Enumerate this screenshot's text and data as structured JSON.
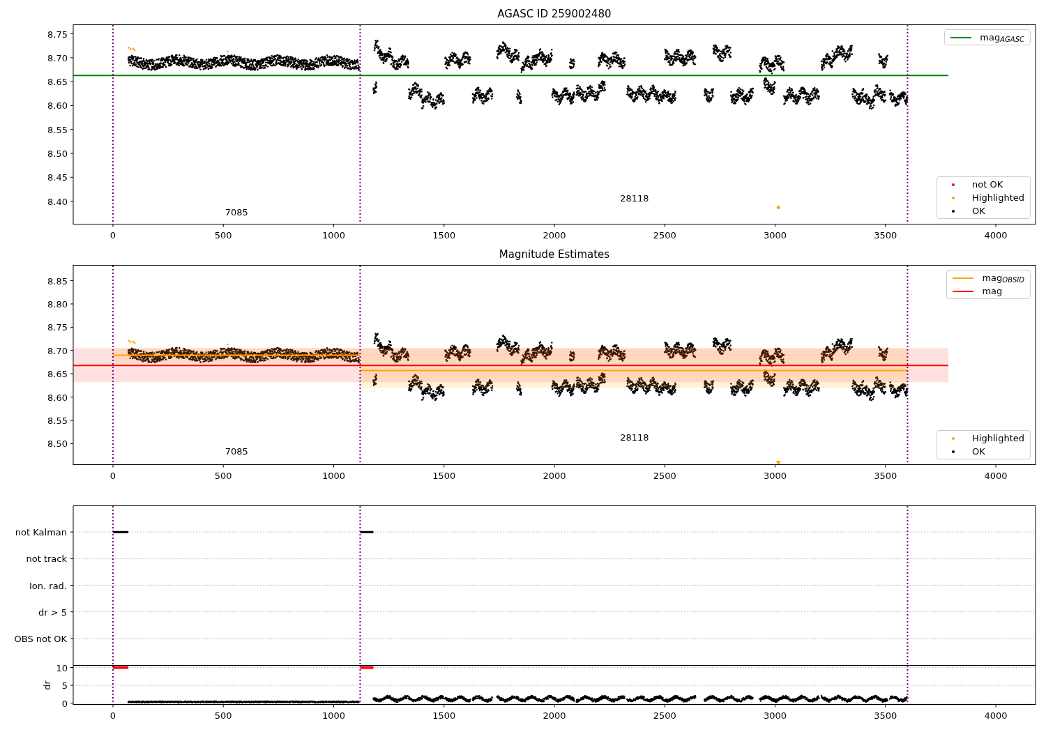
{
  "panels": [
    {
      "chart_data": {
        "type": "scatter",
        "title": "AGASC ID 259002480",
        "xlim": [
          -180,
          4180
        ],
        "ylim": [
          8.352,
          8.769
        ],
        "xticks": [
          0,
          500,
          1000,
          1500,
          2000,
          2500,
          3000,
          3500,
          4000
        ],
        "yticks": [
          {
            "value": 8.4,
            "label": "8.40"
          },
          {
            "value": 8.45,
            "label": "8.45"
          },
          {
            "value": 8.5,
            "label": "8.50"
          },
          {
            "value": 8.55,
            "label": "8.55"
          },
          {
            "value": 8.6,
            "label": "8.60"
          },
          {
            "value": 8.65,
            "label": "8.65"
          },
          {
            "value": 8.7,
            "label": "8.70"
          },
          {
            "value": 8.75,
            "label": "8.75"
          }
        ],
        "series": [
          {
            "type": "line",
            "color": "#008000",
            "x": [
              -180,
              3785
            ],
            "values": [
              8.663,
              8.663
            ]
          },
          {
            "type": "scatter",
            "color": "#ffa500",
            "x": [
              3015
            ],
            "values": [
              8.387
            ]
          }
        ],
        "ref_lines": [
          {
            "axis": "x",
            "value": 0,
            "color": "#800080"
          },
          {
            "axis": "x",
            "value": 1120,
            "color": "#800080"
          },
          {
            "axis": "x",
            "value": 3600,
            "color": "#800080"
          }
        ],
        "annotations": [
          "7085",
          "28118"
        ]
      },
      "legends": [
        {
          "items": [
            {
              "kind": "line",
              "label": "mag$_{AGASC}$",
              "color": "#008000"
            }
          ]
        },
        {
          "items": [
            {
              "kind": "dot",
              "label": "not OK",
              "color": "#ff0000"
            },
            {
              "kind": "dot",
              "label": "Highlighted",
              "color": "#ffa500"
            },
            {
              "kind": "dot",
              "label": "OK",
              "color": "#000000"
            }
          ]
        }
      ]
    },
    {
      "chart_data": {
        "type": "scatter",
        "title": "Magnitude Estimates",
        "xlim": [
          -180,
          4180
        ],
        "ylim": [
          8.455,
          8.883
        ],
        "xticks": [
          0,
          500,
          1000,
          1500,
          2000,
          2500,
          3000,
          3500,
          4000
        ],
        "yticks": [
          {
            "value": 8.5,
            "label": "8.50"
          },
          {
            "value": 8.55,
            "label": "8.55"
          },
          {
            "value": 8.6,
            "label": "8.60"
          },
          {
            "value": 8.65,
            "label": "8.65"
          },
          {
            "value": 8.7,
            "label": "8.70"
          },
          {
            "value": 8.75,
            "label": "8.75"
          },
          {
            "value": 8.8,
            "label": "8.80"
          },
          {
            "value": 8.85,
            "label": "8.85"
          }
        ],
        "series": [
          {
            "type": "line",
            "color": "#ff0000",
            "x": [
              -180,
              3785
            ],
            "values": [
              8.668,
              8.668
            ]
          },
          {
            "type": "line",
            "color": "#ffa500",
            "x": [
              0,
              1120
            ],
            "values": [
              8.69,
              8.69
            ]
          },
          {
            "type": "line",
            "color": "#ffa500",
            "x": [
              1120,
              3600
            ],
            "values": [
              8.657,
              8.657
            ]
          }
        ],
        "ref_lines": [
          {
            "axis": "x",
            "value": 0,
            "color": "#800080"
          },
          {
            "axis": "x",
            "value": 1120,
            "color": "#800080"
          },
          {
            "axis": "x",
            "value": 3600,
            "color": "#800080"
          }
        ],
        "annotations": [
          "7085",
          "28118"
        ]
      },
      "legends": [
        {
          "items": [
            {
              "kind": "line",
              "label": "mag$_{OBSID}$",
              "color": "#ffa500"
            },
            {
              "kind": "line",
              "label": "mag",
              "color": "#ff0000"
            }
          ]
        },
        {
          "items": [
            {
              "kind": "dot",
              "label": "Highlighted",
              "color": "#ffa500"
            },
            {
              "kind": "dot",
              "label": "OK",
              "color": "#000000"
            }
          ]
        }
      ]
    }
  ],
  "flags": {
    "labels": [
      "not Kalman",
      "not track",
      "Ion. rad.",
      "dr > 5",
      "OBS not OK"
    ],
    "chart_data": {
      "type": "scatter",
      "ylabel": "dr",
      "xlim": [
        -180,
        4180
      ],
      "ylim": [
        -0.39,
        10.59
      ],
      "xticks": [
        0,
        500,
        1000,
        1500,
        2000,
        2500,
        3000,
        3500,
        4000
      ],
      "yticks": [
        0,
        5,
        10
      ],
      "series": [
        {
          "type": "line",
          "color": "#ff0000",
          "x": [
            0,
            70
          ],
          "values": [
            10,
            10
          ]
        },
        {
          "type": "line",
          "color": "#ff0000",
          "x": [
            1120,
            1180
          ],
          "values": [
            10,
            10
          ]
        }
      ],
      "ref_lines": [
        {
          "axis": "x",
          "value": 0,
          "color": "#800080"
        },
        {
          "axis": "x",
          "value": 1120,
          "color": "#800080"
        },
        {
          "axis": "x",
          "value": 3600,
          "color": "#800080"
        }
      ]
    }
  }
}
